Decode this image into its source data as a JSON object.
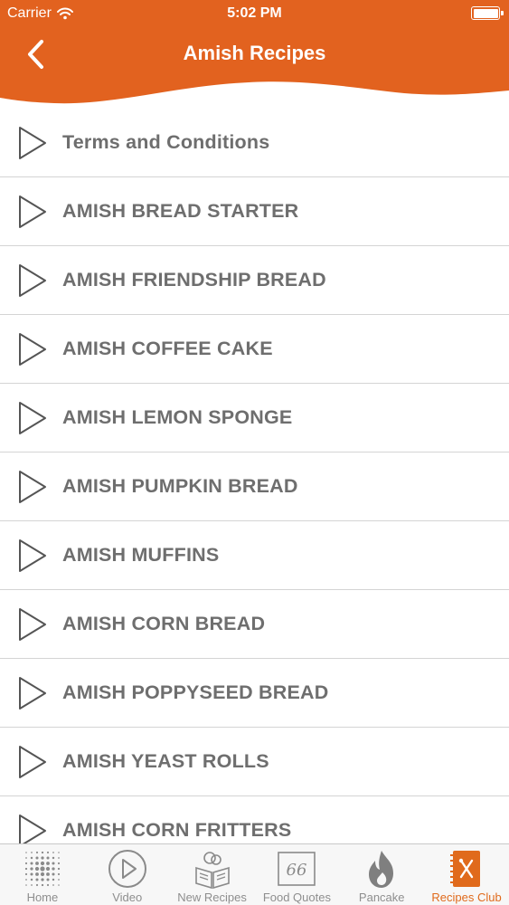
{
  "status_bar": {
    "carrier": "Carrier",
    "time": "5:02 PM"
  },
  "header": {
    "title": "Amish Recipes",
    "back_icon": "chevron-left-icon",
    "color": "#e2621f"
  },
  "list": {
    "items": [
      {
        "label": "Terms and Conditions"
      },
      {
        "label": "AMISH BREAD STARTER"
      },
      {
        "label": "AMISH FRIENDSHIP BREAD"
      },
      {
        "label": "AMISH COFFEE CAKE"
      },
      {
        "label": "AMISH LEMON SPONGE"
      },
      {
        "label": "AMISH PUMPKIN BREAD"
      },
      {
        "label": "AMISH MUFFINS"
      },
      {
        "label": "AMISH CORN BREAD"
      },
      {
        "label": "AMISH POPPYSEED BREAD"
      },
      {
        "label": "AMISH YEAST ROLLS"
      },
      {
        "label": "AMISH CORN FRITTERS"
      }
    ],
    "item_icon": "play-outline-icon"
  },
  "tabbar": {
    "tabs": [
      {
        "label": "Home",
        "icon": "dots-grid-icon"
      },
      {
        "label": "Video",
        "icon": "play-circle-icon"
      },
      {
        "label": "New Recipes",
        "icon": "book-reader-icon"
      },
      {
        "label": "Food Quotes",
        "icon": "quote-icon",
        "icon_text": "66"
      },
      {
        "label": "Pancake",
        "icon": "flame-icon"
      },
      {
        "label": "Recipes Club",
        "icon": "recipe-book-icon",
        "active": true
      }
    ],
    "active_color": "#e06a1c"
  }
}
